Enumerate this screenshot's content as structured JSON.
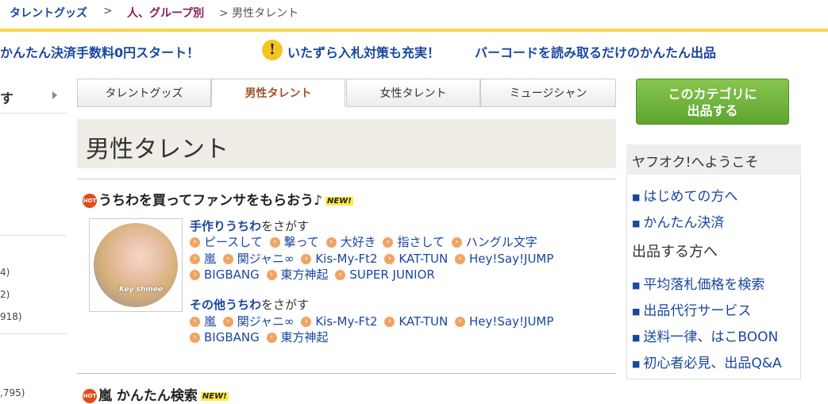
{
  "breadcrumb": {
    "item1": "タレントグッズ",
    "sep": ">",
    "item2": "人、グループ別",
    "current": "> 男性タレント"
  },
  "promos": {
    "p1": "かんたん決済手数料0円スタート！",
    "p2": "いたずら入札対策も充実！",
    "p3": "バーコードを読み取るだけのかんたん出品",
    "warn_icon": "!"
  },
  "left_sidebar": {
    "item_label": "す",
    "counts": [
      "4)",
      "2)",
      "918)",
      ",795)"
    ]
  },
  "tabs": [
    "タレントグッズ",
    "男性タレント",
    "女性タレント",
    "ミュージシャン"
  ],
  "page_title": "男性タレント",
  "section1": {
    "hot": "HOT",
    "heading": "うちわを買ってファンサをもらおう♪",
    "new": "NEW!",
    "thumb_caption": "Key shinee",
    "search1_bold": "手作りうちわ",
    "search1_rest": "をさがす",
    "search1_rows": [
      [
        "ピースして",
        "撃って",
        "大好き",
        "指さして",
        "ハングル文字"
      ],
      [
        "嵐",
        "関ジャニ∞",
        "Kis-My-Ft2",
        "KAT-TUN",
        "Hey!Say!JUMP"
      ],
      [
        "BIGBANG",
        "東方神起",
        "SUPER JUNIOR"
      ]
    ],
    "search2_bold": "その他うちわ",
    "search2_rest": "をさがす",
    "search2_rows": [
      [
        "嵐",
        "関ジャニ∞",
        "Kis-My-Ft2",
        "KAT-TUN",
        "Hey!Say!JUMP"
      ],
      [
        "BIGBANG",
        "東方神起"
      ]
    ]
  },
  "section2": {
    "hot": "HOT",
    "heading": "嵐 かんたん検索",
    "new": "NEW!"
  },
  "right": {
    "sell_button": [
      "このカテゴリに",
      "出品する"
    ],
    "welcome_title": "ヤフオク!へようこそ",
    "links1": [
      "はじめての方へ",
      "かんたん決済"
    ],
    "sub_heading": "出品する方へ",
    "links2": [
      "平均落札価格を検索",
      "出品代行サービス",
      "送料一律、はこBOON",
      "初心者必見、出品Q&A"
    ],
    "bullet": "■"
  },
  "colors": {
    "accent_link": "#1a47a0",
    "breadcrumb_group": "#8b1a5a",
    "yellow_line": "#f5d54a",
    "sell_green": "#6fb33c",
    "dot_orange": "#f0a463"
  },
  "icons": {
    "warn": "warning-icon",
    "arrow": "chevron-right-icon",
    "hot": "hot-badge-icon",
    "dot": "arrow-circle-icon"
  }
}
